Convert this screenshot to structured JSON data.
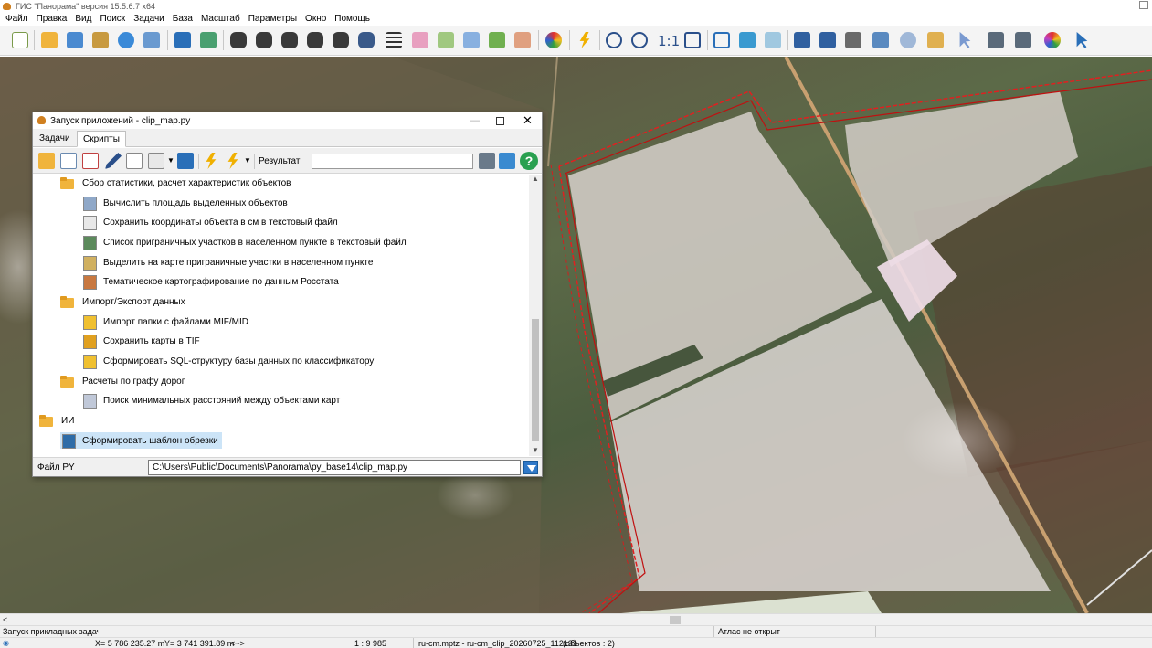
{
  "app": {
    "title": "ГИС \"Панорама\" версия 15.5.6.7 x64"
  },
  "menu": [
    "Файл",
    "Правка",
    "Вид",
    "Поиск",
    "Задачи",
    "База",
    "Масштаб",
    "Параметры",
    "Окно",
    "Помощь"
  ],
  "toolbar": {
    "scale_label": "1:1",
    "icons": [
      "new-map-icon",
      "open-map-icon",
      "open-data-icon",
      "database-icon",
      "globe-icon",
      "layers-icon",
      "binoculars-icon",
      "search-area-icon",
      "list-icon",
      "select-object-icon",
      "edit-object-icon",
      "lightning-icon",
      "zoom-out-icon",
      "zoom-in-icon",
      "fit-icon",
      "cursor-icon",
      "print-icon",
      "color-wheel-icon",
      "help-cursor-icon"
    ],
    "colors": {
      "accent": "#2a6fb8",
      "lightning": "#f0b000"
    }
  },
  "dialog": {
    "title": "Запуск приложений - clip_map.py",
    "tabs": [
      {
        "label": "Задачи",
        "active": false
      },
      {
        "label": "Скрипты",
        "active": true
      }
    ],
    "result_label": "Результат",
    "result_value": "",
    "help_label": "?",
    "file_label": "Файл PY",
    "file_path": "C:\\Users\\Public\\Documents\\Panorama\\py_base14\\clip_map.py",
    "tree": [
      {
        "level": 1,
        "type": "folder",
        "label": "Сбор статистики, расчет характеристик объектов"
      },
      {
        "level": 2,
        "type": "script",
        "icon": "calculator-icon",
        "color": "c1",
        "label": "Вычислить площадь выделенных объектов"
      },
      {
        "level": 2,
        "type": "script",
        "icon": "xy-coordinates-icon",
        "color": "c2",
        "label": "Сохранить координаты объекта в см в текстовый файл"
      },
      {
        "level": 2,
        "type": "script",
        "icon": "list-parcels-icon",
        "color": "c3",
        "label": "Список приграничных участков в населенном пункте в текстовый файл"
      },
      {
        "level": 2,
        "type": "script",
        "icon": "highlight-parcels-icon",
        "color": "c4",
        "label": "Выделить на карте приграничные участки в населенном пункте"
      },
      {
        "level": 2,
        "type": "script",
        "icon": "thematic-map-icon",
        "color": "c5",
        "label": "Тематическое картографирование по данным Росстата"
      },
      {
        "level": 1,
        "type": "folder",
        "label": "Импорт/Экспорт данных"
      },
      {
        "level": 2,
        "type": "script",
        "icon": "mif-folder-icon",
        "color": "c6",
        "label": "Импорт папки с файлами MIF/MID"
      },
      {
        "level": 2,
        "type": "script",
        "icon": "tif-folder-icon",
        "color": "c7",
        "label": "Сохранить карты в TIF"
      },
      {
        "level": 2,
        "type": "script",
        "icon": "sql-structure-icon",
        "color": "c6",
        "label": "Сформировать SQL-структуру базы данных по классификатору"
      },
      {
        "level": 1,
        "type": "folder",
        "label": "Расчеты по графу дорог"
      },
      {
        "level": 2,
        "type": "script",
        "icon": "graph-distance-icon",
        "color": "c8",
        "label": "Поиск минимальных расстояний между объектами карт"
      },
      {
        "level": 0,
        "type": "folder",
        "label": "ИИ"
      },
      {
        "level": 1,
        "type": "script",
        "icon": "python-file-icon",
        "color": "c9",
        "label": "Сформировать шаблон обрезки",
        "selected": true
      }
    ]
  },
  "status": {
    "task": "Запуск прикладных задач",
    "atlas": "Атлас не открыт",
    "x": "X= 5 786 235.27 m",
    "y": "Y= 3 741 391.89 m",
    "arrows": "<~>",
    "scale": "1 : 9 985",
    "doc": "ru-cm.mptz - ru-cm_clip_20260725_112131",
    "objects": "(объектов : 2)"
  }
}
